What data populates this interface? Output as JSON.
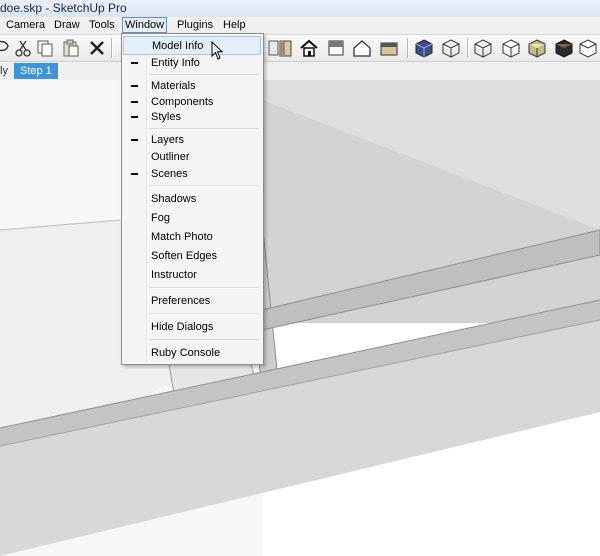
{
  "window": {
    "title": "doe.skp - SketchUp Pro"
  },
  "menubar": {
    "items": [
      {
        "label": "Camera"
      },
      {
        "label": "Draw"
      },
      {
        "label": "Tools"
      },
      {
        "label": "Window"
      },
      {
        "label": "Plugins"
      },
      {
        "label": "Help"
      }
    ],
    "open_menu": "Window"
  },
  "toolbar": {
    "icons": [
      "lasso-icon",
      "cut-icon",
      "copy-icon",
      "paste-icon",
      "erase-icon",
      "undo-icon",
      "home-icon",
      "door-icon",
      "house-iso-icon",
      "house-front-icon",
      "house-outline-icon",
      "section-icon",
      "xray-cube-icon",
      "wireframe-cube-icon",
      "hidden-line-cube-icon",
      "shaded-cube-icon",
      "textured-cube-icon",
      "monochrome-cube-icon",
      "iso-cube-icon"
    ]
  },
  "scenes": {
    "prev_tab_fragment": "ly",
    "active_tab": "Step 1"
  },
  "window_menu": {
    "items": [
      {
        "label": "Model Info",
        "checked": false,
        "hover": true
      },
      {
        "label": "Entity Info",
        "checked": true
      },
      {
        "label": "Materials",
        "checked": true
      },
      {
        "label": "Components",
        "checked": true
      },
      {
        "label": "Styles",
        "checked": true
      },
      {
        "label": "Layers",
        "checked": true
      },
      {
        "label": "Outliner",
        "checked": false
      },
      {
        "label": "Scenes",
        "checked": true
      },
      {
        "label": "Shadows",
        "checked": false
      },
      {
        "label": "Fog",
        "checked": false
      },
      {
        "label": "Match Photo",
        "checked": false
      },
      {
        "label": "Soften Edges",
        "checked": false
      },
      {
        "label": "Instructor",
        "checked": false
      },
      {
        "label": "Preferences",
        "checked": false
      },
      {
        "label": "Hide Dialogs",
        "checked": false
      },
      {
        "label": "Ruby Console",
        "checked": false
      }
    ]
  },
  "colors": {
    "accent": "#3e93dd",
    "menu_hover": "#e4eefa"
  }
}
